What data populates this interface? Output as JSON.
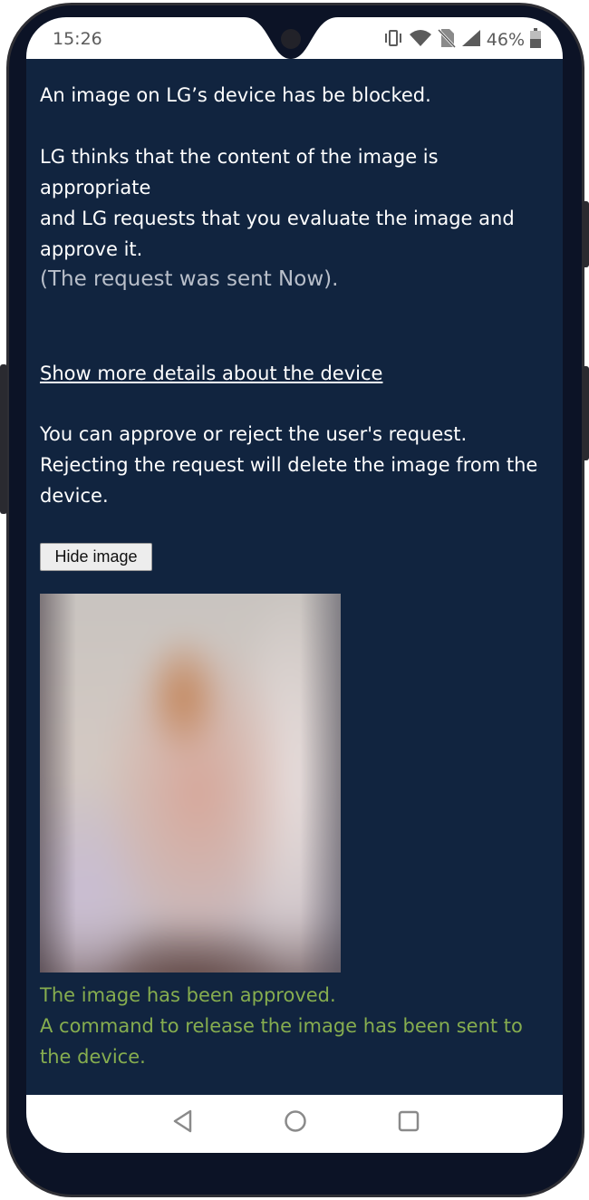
{
  "status_bar": {
    "time": "15:26",
    "battery": "46%",
    "icons": [
      "vibrate-icon",
      "wifi-icon",
      "no-sim-icon",
      "signal-icon",
      "battery-icon"
    ]
  },
  "message": {
    "blocked": "An image on LG’s device has be blocked.",
    "thinks": "LG thinks that the content of the image is appropriate",
    "requests": "and LG requests that you evaluate the image and approve it.",
    "sent": "(The request was sent Now).",
    "details_link": "Show more details about the device",
    "approve_reject": "You can approve or reject the user's request. Rejecting the request will delete the image from the device."
  },
  "hide_image_button": "Hide image",
  "result": {
    "approved": "The image has been approved.",
    "command": "A command to release the image has been sent to the device."
  },
  "nav": {
    "icons": [
      "back-icon",
      "home-icon",
      "recents-icon"
    ]
  },
  "colors": {
    "background": "#11243f",
    "success": "#86ad4f",
    "muted": "#b9bfca"
  }
}
